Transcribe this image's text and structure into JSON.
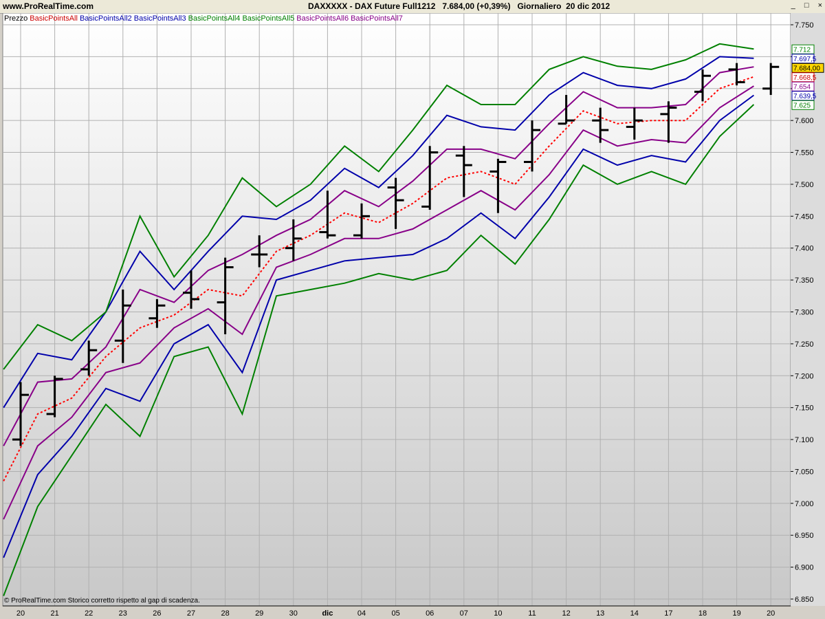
{
  "header": {
    "site": "www.ProRealTime.com",
    "title": "DAXXXXX - DAX Future Full1212   7.684,00 (+0,39%)   Giornaliero  20 dic 2012",
    "minimize_label": "_",
    "restore_label": "□",
    "close_label": "×"
  },
  "legend": [
    {
      "label": "Prezzo",
      "color": "#000000"
    },
    {
      "label": "BasicPointsAll",
      "color": "#cc0000"
    },
    {
      "label": "BasicPointsAll2",
      "color": "#0000aa"
    },
    {
      "label": "BasicPointsAll3",
      "color": "#0000aa"
    },
    {
      "label": "BasicPointsAll4",
      "color": "#008000"
    },
    {
      "label": "BasicPointsAll5",
      "color": "#008000"
    },
    {
      "label": "BasicPointsAll6",
      "color": "#880088"
    },
    {
      "label": "BasicPointsAll7",
      "color": "#880088"
    }
  ],
  "footer_note": "© ProRealTime.com  Storico corretto rispetto al gap di scadenza.",
  "chart_data": {
    "type": "line",
    "subtype": "ohlc-bars-with-bands",
    "ylim": [
      6850,
      7750
    ],
    "yticks": [
      6850,
      6900,
      6950,
      7000,
      7050,
      7100,
      7150,
      7200,
      7250,
      7300,
      7350,
      7400,
      7450,
      7500,
      7550,
      7600,
      7650,
      7700,
      7750
    ],
    "ytick_labels": [
      "6.850",
      "6.900",
      "6.950",
      "7.000",
      "7.050",
      "7.100",
      "7.150",
      "7.200",
      "7.250",
      "7.300",
      "7.350",
      "7.400",
      "7.450",
      "7.500",
      "7.550",
      "7.600",
      "7.650",
      "7.700",
      "7.750"
    ],
    "categories": [
      "20",
      "21",
      "22",
      "23",
      "26",
      "27",
      "28",
      "29",
      "30",
      "dic",
      "04",
      "05",
      "06",
      "07",
      "10",
      "11",
      "12",
      "13",
      "14",
      "17",
      "18",
      "19",
      "20"
    ],
    "ohlc": [
      {
        "open": 7100,
        "high": 7190,
        "low": 7090,
        "close": 7170
      },
      {
        "open": 7140,
        "high": 7200,
        "low": 7135,
        "close": 7195
      },
      {
        "open": 7210,
        "high": 7255,
        "low": 7200,
        "close": 7240
      },
      {
        "open": 7255,
        "high": 7335,
        "low": 7220,
        "close": 7310
      },
      {
        "open": 7290,
        "high": 7320,
        "low": 7275,
        "close": 7310
      },
      {
        "open": 7330,
        "high": 7365,
        "low": 7305,
        "close": 7320
      },
      {
        "open": 7315,
        "high": 7385,
        "low": 7265,
        "close": 7370
      },
      {
        "open": 7390,
        "high": 7420,
        "low": 7370,
        "close": 7390
      },
      {
        "open": 7400,
        "high": 7445,
        "low": 7380,
        "close": 7415
      },
      {
        "open": 7425,
        "high": 7490,
        "low": 7415,
        "close": 7420
      },
      {
        "open": 7420,
        "high": 7470,
        "low": 7415,
        "close": 7450
      },
      {
        "open": 7495,
        "high": 7510,
        "low": 7430,
        "close": 7475
      },
      {
        "open": 7465,
        "high": 7560,
        "low": 7460,
        "close": 7550
      },
      {
        "open": 7545,
        "high": 7560,
        "low": 7480,
        "close": 7530
      },
      {
        "open": 7520,
        "high": 7540,
        "low": 7455,
        "close": 7535
      },
      {
        "open": 7535,
        "high": 7600,
        "low": 7520,
        "close": 7585
      },
      {
        "open": 7595,
        "high": 7640,
        "low": 7595,
        "close": 7600
      },
      {
        "open": 7600,
        "high": 7620,
        "low": 7565,
        "close": 7585
      },
      {
        "open": 7590,
        "high": 7620,
        "low": 7570,
        "close": 7600
      },
      {
        "open": 7610,
        "high": 7630,
        "low": 7565,
        "close": 7620
      },
      {
        "open": 7645,
        "high": 7680,
        "low": 7630,
        "close": 7670
      },
      {
        "open": 7680,
        "high": 7690,
        "low": 7655,
        "close": 7660
      },
      {
        "open": 7650,
        "high": 7690,
        "low": 7640,
        "close": 7684
      }
    ],
    "series": [
      {
        "name": "BasicPointsAll",
        "color": "#ff0000",
        "dashed": true,
        "values": [
          7035,
          7140,
          7165,
          7230,
          7275,
          7295,
          7335,
          7325,
          7395,
          7420,
          7455,
          7440,
          7470,
          7510,
          7520,
          7500,
          7560,
          7615,
          7595,
          7600,
          7600,
          7650,
          7668.5
        ]
      },
      {
        "name": "BasicPointsAll2",
        "color": "#0000aa",
        "values": [
          7150,
          7235,
          7225,
          7300,
          7395,
          7335,
          7395,
          7450,
          7445,
          7475,
          7525,
          7495,
          7545,
          7608,
          7590,
          7585,
          7640,
          7675,
          7655,
          7650,
          7665,
          7700,
          7697.5
        ]
      },
      {
        "name": "BasicPointsAll3",
        "color": "#0000aa",
        "values": [
          6915,
          7045,
          7105,
          7180,
          7160,
          7250,
          7280,
          7205,
          7350,
          7365,
          7380,
          7385,
          7390,
          7415,
          7455,
          7415,
          7480,
          7555,
          7530,
          7545,
          7535,
          7600,
          7639.5
        ]
      },
      {
        "name": "BasicPointsAll4",
        "color": "#008000",
        "values": [
          7210,
          7280,
          7255,
          7300,
          7450,
          7355,
          7420,
          7510,
          7465,
          7500,
          7560,
          7520,
          7585,
          7655,
          7625,
          7625,
          7680,
          7700,
          7685,
          7680,
          7695,
          7720,
          7712
        ]
      },
      {
        "name": "BasicPointsAll5",
        "color": "#008000",
        "values": [
          6855,
          6995,
          7075,
          7155,
          7105,
          7230,
          7245,
          7140,
          7325,
          7335,
          7345,
          7360,
          7350,
          7365,
          7420,
          7375,
          7445,
          7530,
          7500,
          7520,
          7500,
          7575,
          7625
        ]
      },
      {
        "name": "BasicPointsAll6",
        "color": "#880088",
        "values": [
          7090,
          7190,
          7195,
          7245,
          7335,
          7315,
          7365,
          7390,
          7420,
          7445,
          7490,
          7465,
          7505,
          7555,
          7555,
          7540,
          7595,
          7645,
          7620,
          7620,
          7625,
          7675,
          7684
        ]
      },
      {
        "name": "BasicPointsAll7",
        "color": "#880088",
        "values": [
          6975,
          7090,
          7135,
          7205,
          7220,
          7275,
          7305,
          7265,
          7370,
          7390,
          7415,
          7415,
          7430,
          7460,
          7490,
          7460,
          7515,
          7585,
          7560,
          7570,
          7565,
          7620,
          7654
        ]
      }
    ],
    "right_labels": [
      {
        "text": "7.712",
        "value": 7712,
        "color": "#008000"
      },
      {
        "text": "7.697,5",
        "value": 7697.5,
        "color": "#0000aa"
      },
      {
        "text": "7.684,00",
        "value": 7684,
        "color": "#000000",
        "highlight": true
      },
      {
        "text": "7.668,5",
        "value": 7668.5,
        "color": "#cc0000"
      },
      {
        "text": "7.654",
        "value": 7654,
        "color": "#880088"
      },
      {
        "text": "7.639,5",
        "value": 7639.5,
        "color": "#0000aa"
      },
      {
        "text": "7.625",
        "value": 7625,
        "color": "#008000"
      }
    ]
  }
}
